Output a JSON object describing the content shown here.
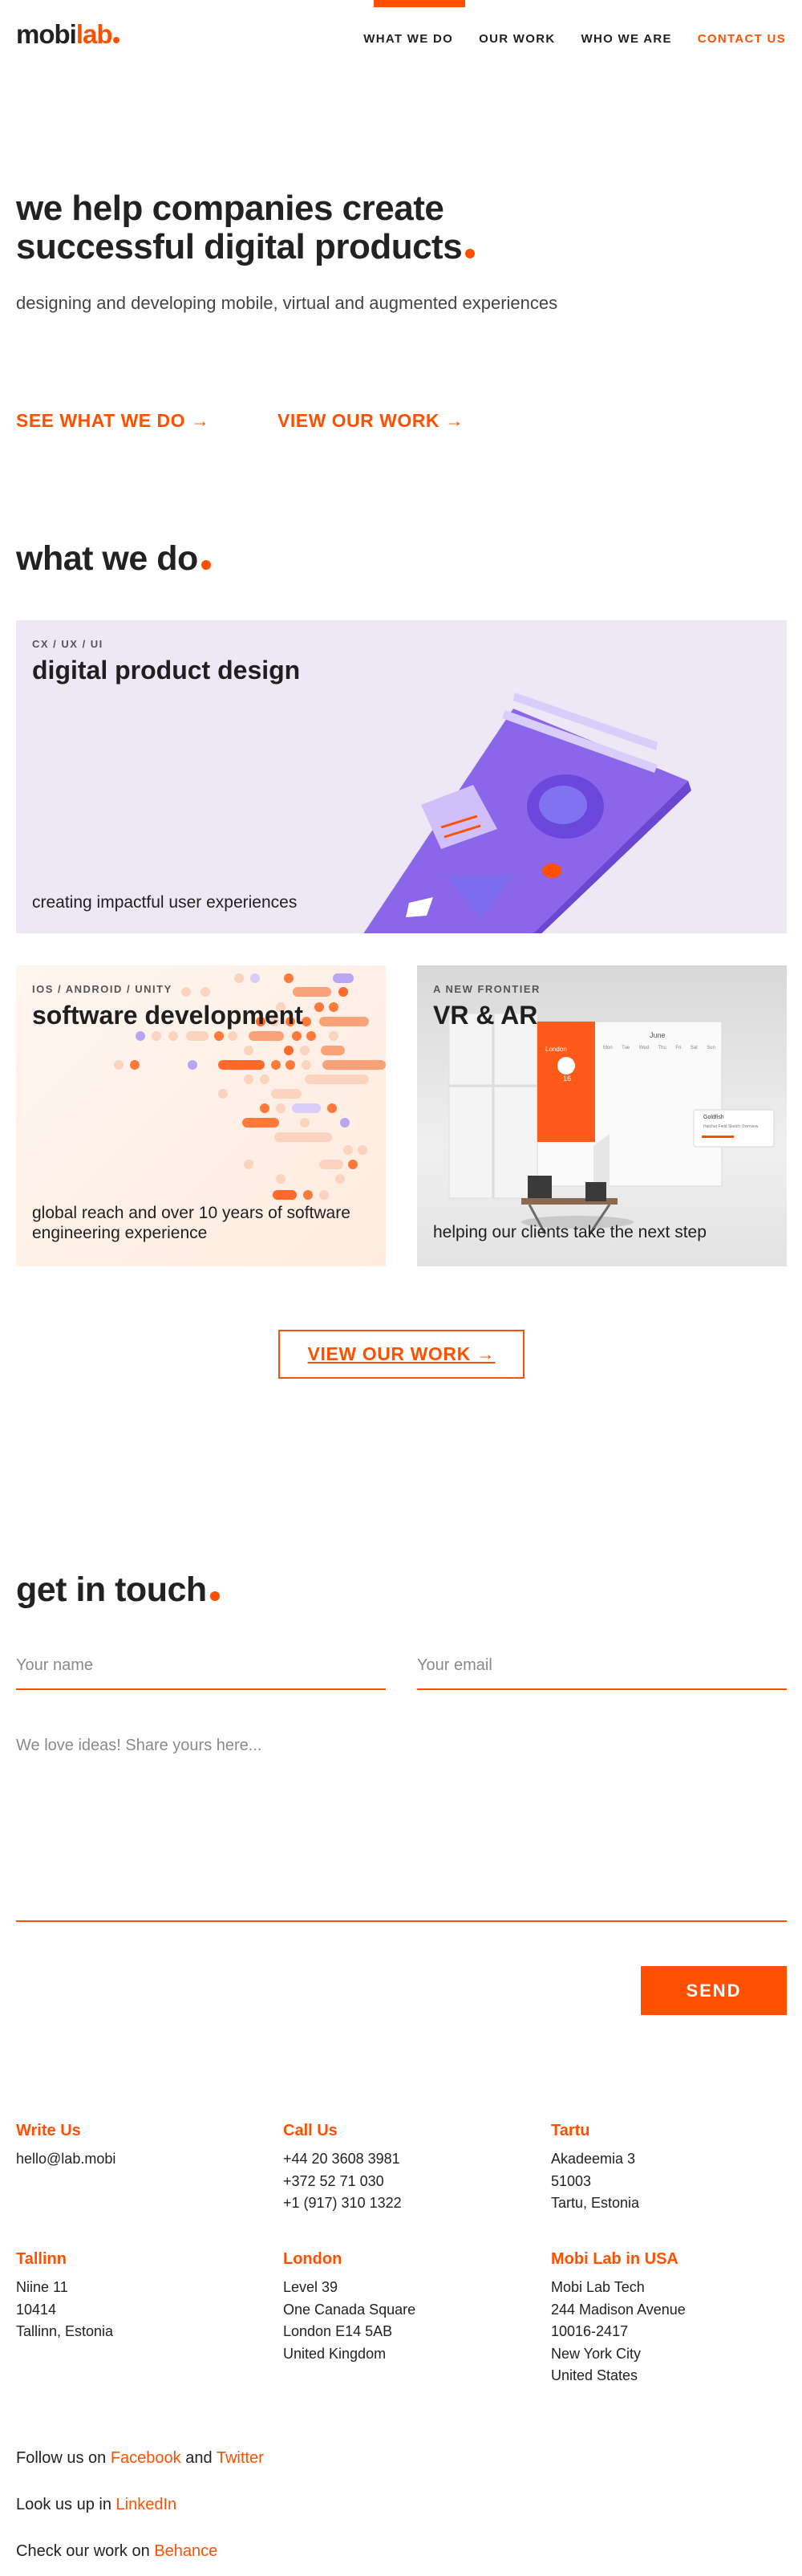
{
  "header": {
    "logo_main": "mobi",
    "logo_accent": "lab",
    "nav": [
      "WHAT WE DO",
      "OUR WORK",
      "WHO WE ARE",
      "CONTACT US"
    ]
  },
  "hero": {
    "title_line1": "we help companies create",
    "title_line2": "successful digital products",
    "subtitle": "designing and developing mobile, virtual and augmented experiences",
    "cta_primary": "SEE WHAT WE DO →",
    "cta_secondary": "VIEW OUR WORK →"
  },
  "what_we_do": {
    "title": "what we do",
    "cards": [
      {
        "tag": "CX / UX / UI",
        "title": "digital product design",
        "desc": "creating impactful user experiences"
      },
      {
        "tag": "IOS / ANDROID / UNITY",
        "title": "software development",
        "desc": "global reach and over 10 years of software engineering experience"
      },
      {
        "tag": "A NEW FRONTIER",
        "title": "VR & AR",
        "desc": "helping our clients take the next step"
      }
    ],
    "view_work_button": "VIEW OUR WORK →",
    "mockup": {
      "city": "London",
      "temp": "16",
      "month": "June",
      "weekdays": [
        "Mon",
        "Tue",
        "Wed",
        "Thu",
        "Fri",
        "Sat",
        "Sun"
      ],
      "popup_title": "Goldfish",
      "popup_sub": "Hatchet Field Sketch Overview"
    }
  },
  "contact": {
    "title": "get in touch",
    "name_placeholder": "Your name",
    "email_placeholder": "Your email",
    "message_placeholder": "We love ideas! Share yours here...",
    "send_label": "SEND"
  },
  "footer": {
    "columns": [
      {
        "heading": "Write Us",
        "lines": [
          "hello@lab.mobi"
        ]
      },
      {
        "heading": "Call Us",
        "lines": [
          "+44 20 3608 3981",
          "+372 52 71 030",
          "+1 (917) 310 1322"
        ]
      },
      {
        "heading": "Tartu",
        "lines": [
          "Akadeemia 3",
          "51003",
          "Tartu, Estonia"
        ]
      },
      {
        "heading": "Tallinn",
        "lines": [
          "Niine 11",
          "10414",
          "Tallinn, Estonia"
        ]
      },
      {
        "heading": "London",
        "lines": [
          "Level 39",
          "One Canada Square",
          "London E14 5AB",
          "United Kingdom"
        ]
      },
      {
        "heading": "Mobi Lab in USA",
        "lines": [
          "Mobi Lab Tech",
          "244 Madison Avenue",
          "10016-2417",
          "New York City",
          "United States"
        ]
      }
    ],
    "follow_text": "Follow us on",
    "facebook": "Facebook",
    "and_text": "and",
    "twitter": "Twitter",
    "lookup_text": "Look us up in",
    "linkedin": "LinkedIn",
    "check_text": "Check our work on",
    "behance": "Behance"
  },
  "colors": {
    "accent": "#ff5000",
    "text": "#1f1f1f",
    "lavender": "#ede7f6",
    "purple": "#9c7af0"
  }
}
